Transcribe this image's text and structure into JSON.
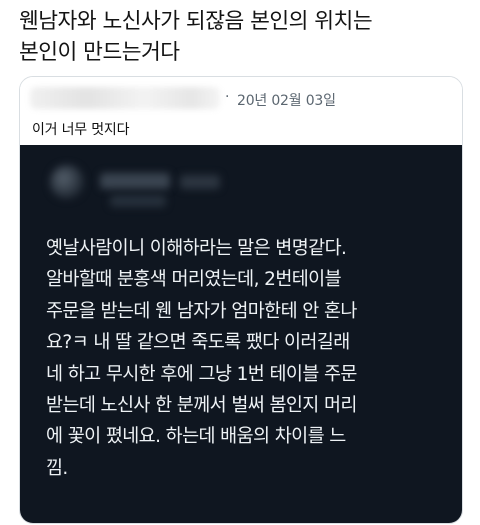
{
  "headline": "웬남자와 노신사가 되잖음 본인의 위치는\n본인이 만드는거다",
  "quote": {
    "separator": "·",
    "date": "20년 02월 03일",
    "text": "이거 너무 멋지다"
  },
  "tweet_image": {
    "body": "옛날사람이니 이해하라는 말은 변명같다.\n알바할때 분홍색 머리였는데, 2번테이블\n주문을 받는데 웬 남자가 엄마한테 안 혼나\n요?ㅋ 내 딸 같으면 죽도록 팼다 이러길래\n네 하고 무시한 후에 그냥 1번 테이블 주문\n받는데 노신사 한 분께서 벌써 봄인지 머리\n에 꽃이 폈네요. 하는데 배움의 차이를 느\n낌."
  }
}
